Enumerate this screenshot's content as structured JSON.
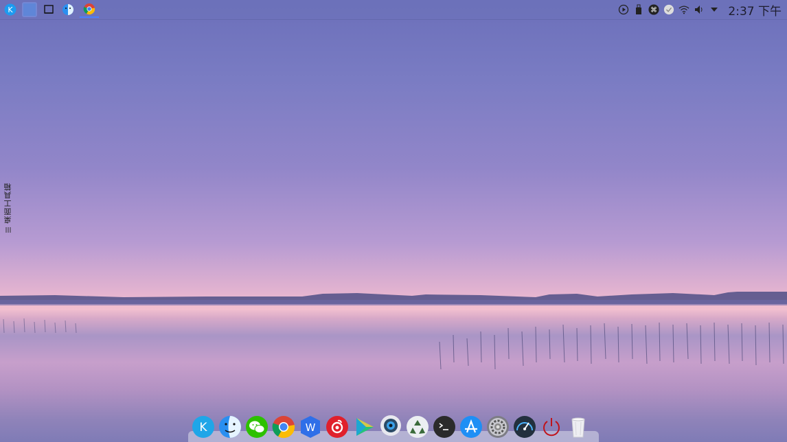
{
  "top_panel": {
    "launchers": [
      {
        "name": "kde-launcher",
        "icon": "kde-icon"
      },
      {
        "name": "workspace-1",
        "icon": "workspace-icon"
      },
      {
        "name": "show-desktop",
        "icon": "window-icon"
      },
      {
        "name": "finder",
        "icon": "finder-icon"
      },
      {
        "name": "chrome-task",
        "icon": "chrome-icon"
      }
    ],
    "tray": [
      {
        "icon": "media-play-icon"
      },
      {
        "icon": "usb-drive-icon"
      },
      {
        "icon": "command-icon"
      },
      {
        "icon": "check-icon"
      },
      {
        "icon": "wifi-icon"
      },
      {
        "icon": "volume-icon"
      },
      {
        "icon": "dropdown-arrow-icon"
      }
    ],
    "clock": "2:37 下午"
  },
  "desktop_toolbox": {
    "label": "桌面工具箱"
  },
  "dock": {
    "items": [
      {
        "name": "kde-launcher",
        "icon": "kde-icon"
      },
      {
        "name": "finder",
        "icon": "finder-icon"
      },
      {
        "name": "wechat",
        "icon": "wechat-icon"
      },
      {
        "name": "chrome",
        "icon": "chrome-icon"
      },
      {
        "name": "wps",
        "icon": "wps-icon"
      },
      {
        "name": "netease-music",
        "icon": "netease-music-icon"
      },
      {
        "name": "media-player",
        "icon": "media-player-icon"
      },
      {
        "name": "camera",
        "icon": "camera-icon"
      },
      {
        "name": "recycle",
        "icon": "recycle-icon"
      },
      {
        "name": "terminal",
        "icon": "terminal-icon"
      },
      {
        "name": "app-store",
        "icon": "app-store-icon"
      },
      {
        "name": "system-settings",
        "icon": "gear-icon"
      },
      {
        "name": "speedometer",
        "icon": "speedometer-icon"
      },
      {
        "name": "power",
        "icon": "power-icon"
      },
      {
        "name": "trash",
        "icon": "trash-icon"
      }
    ]
  },
  "colors": {
    "panel": "#6e73b9",
    "accent": "#4a80ff"
  }
}
